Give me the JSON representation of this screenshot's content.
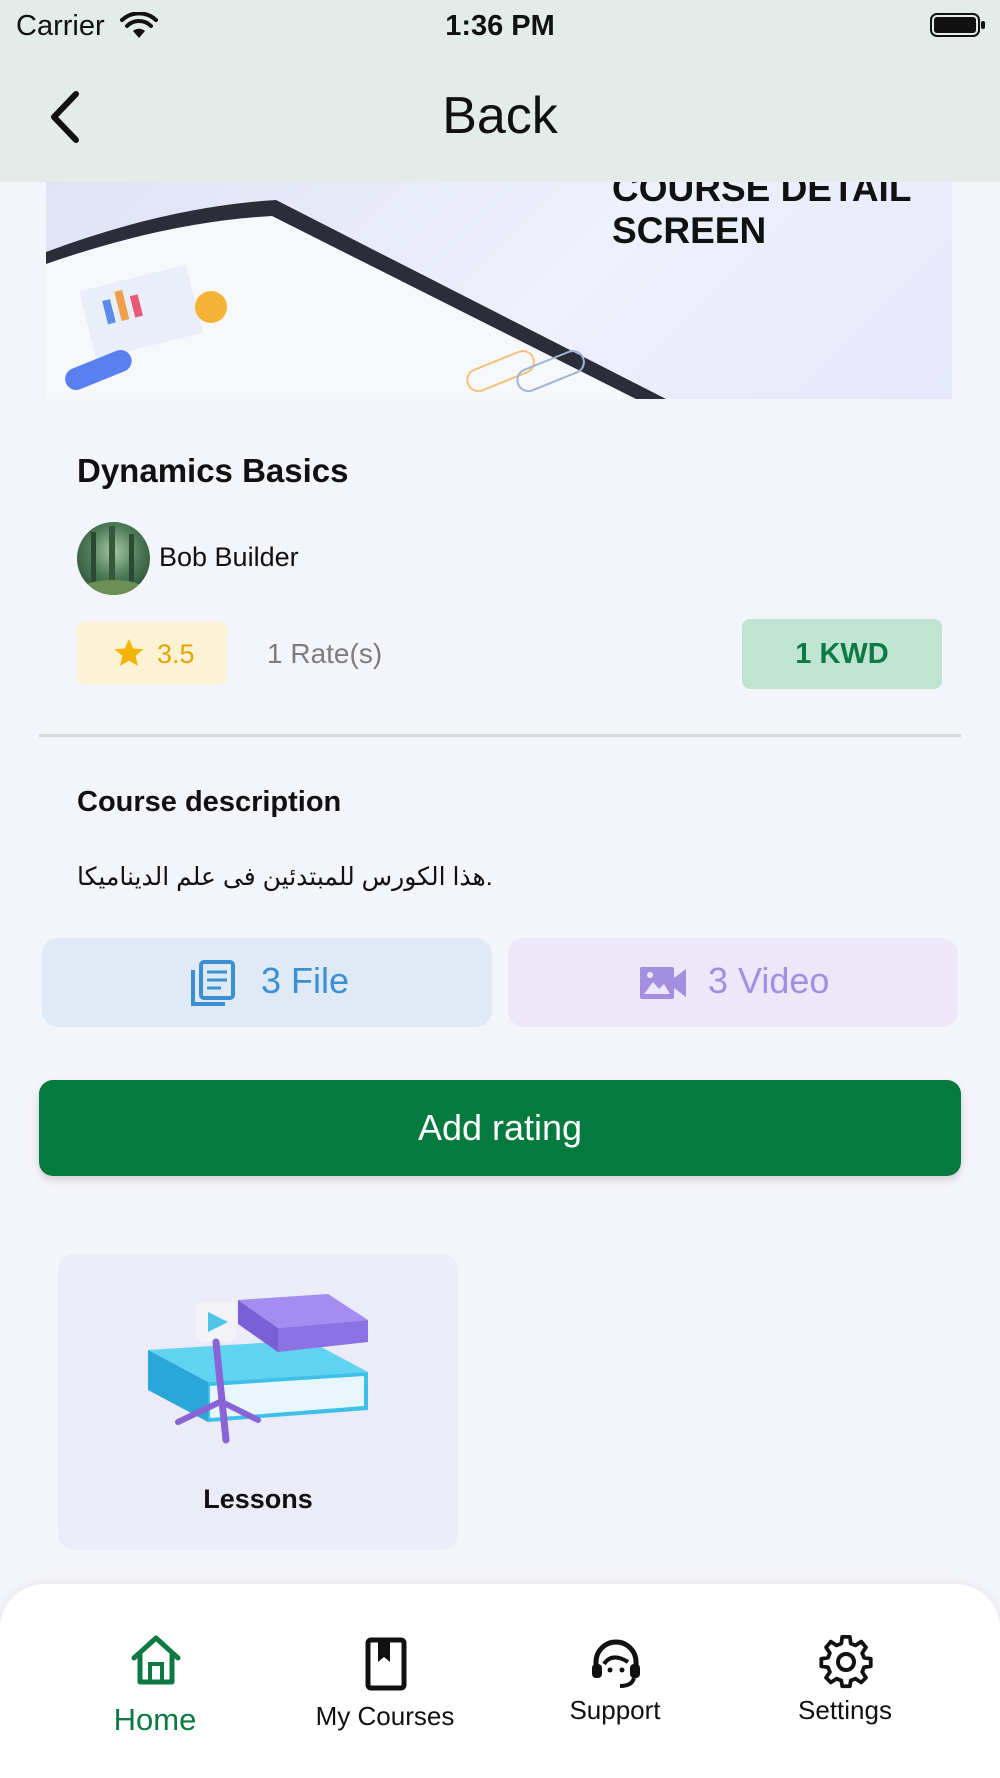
{
  "status_bar": {
    "carrier": "Carrier",
    "time": "1:36 PM"
  },
  "nav": {
    "title": "Back"
  },
  "banner": {
    "text": "COURSE DETAIL SCREEN"
  },
  "course": {
    "title": "Dynamics Basics",
    "instructor": "Bob Builder",
    "rating": "3.5",
    "rating_level": 3.5,
    "rates_count": "1 Rate(s)",
    "price": "1 KWD"
  },
  "description": {
    "heading": "Course description",
    "text": "هذا الكورس للمبتدئين فى علم الديناميكا."
  },
  "resources": {
    "files": "3 File",
    "videos": "3 Video"
  },
  "actions": {
    "add_rating": "Add rating"
  },
  "lessons": {
    "label": "Lessons"
  },
  "tabs": [
    {
      "label": "Home",
      "icon": "home-icon",
      "active": true
    },
    {
      "label": "My Courses",
      "icon": "book-icon"
    },
    {
      "label": "Support",
      "icon": "headset-icon"
    },
    {
      "label": "Settings",
      "icon": "gear-icon"
    }
  ],
  "colors": {
    "primary_green": "#047a3f",
    "price_bg": "#bfe5d2",
    "rating_bg": "#fdf3d4",
    "file_blue": "#3b8fd3",
    "video_purple": "#a38ee0"
  }
}
